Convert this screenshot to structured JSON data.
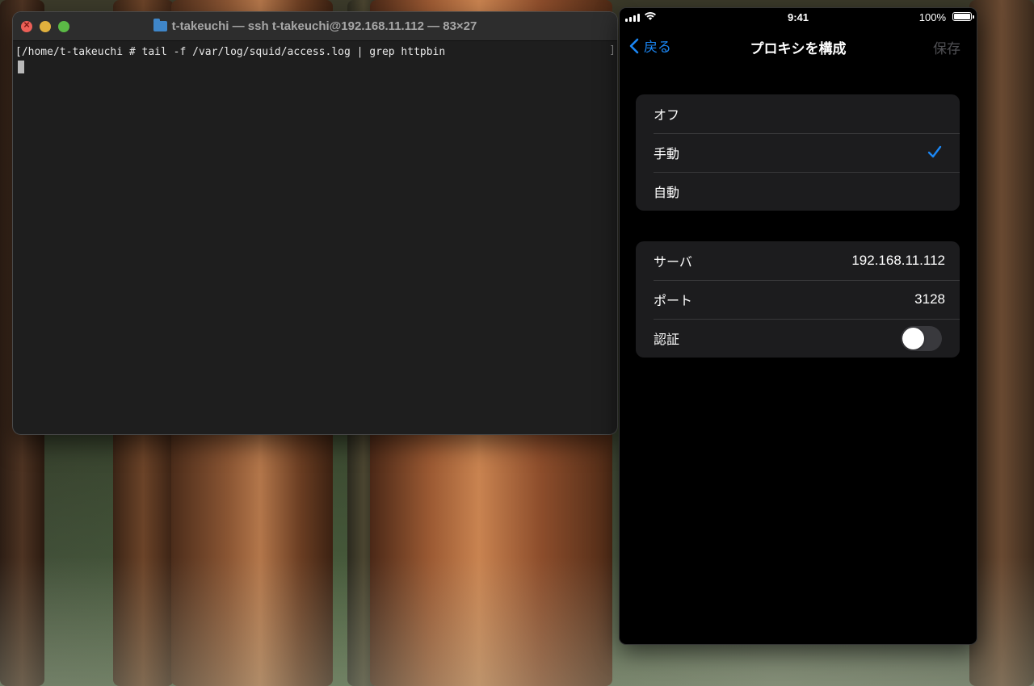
{
  "terminal": {
    "title": "t-takeuchi — ssh t-takeuchi@192.168.11.112 — 83×27",
    "lines": [
      "[/home/t-takeuchi # tail -f /var/log/squid/access.log | grep httpbin"
    ],
    "bracket": "]"
  },
  "phone": {
    "status": {
      "time": "9:41",
      "battery": "100%"
    },
    "nav": {
      "back": "戻る",
      "title": "プロキシを構成",
      "save": "保存"
    },
    "modes": [
      {
        "label": "オフ",
        "selected": false
      },
      {
        "label": "手動",
        "selected": true
      },
      {
        "label": "自動",
        "selected": false
      }
    ],
    "settings": {
      "server_label": "サーバ",
      "server_value": "192.168.11.112",
      "port_label": "ポート",
      "port_value": "3128",
      "auth_label": "認証",
      "auth_enabled": false
    }
  },
  "colors": {
    "accent": "#1b87f5",
    "terminal_bg": "#1e1e1e",
    "group_bg": "#1c1c1e"
  }
}
